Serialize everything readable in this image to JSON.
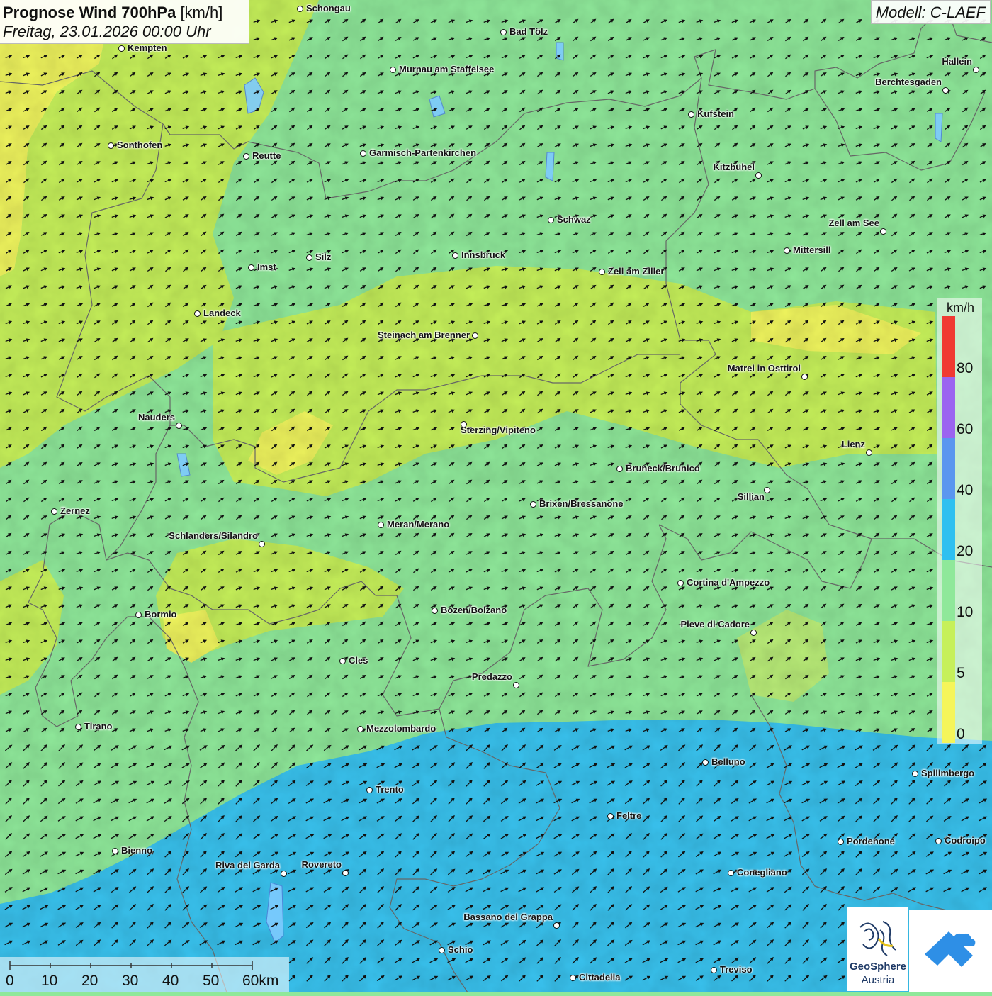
{
  "title": {
    "bold": "Prognose Wind 700hPa",
    "unit": "[km/h]",
    "date": "Freitag, 23.01.2026 00:00 Uhr"
  },
  "model": "Modell: C-LAEF",
  "legend": {
    "unit": "km/h",
    "ticks": [
      "80",
      "60",
      "40",
      "20",
      "10",
      "5",
      "0"
    ],
    "colors": {
      "above_80": "#f03a32",
      "60_80": "#9b64f0",
      "40_60": "#5a96ef",
      "20_40": "#2ec0f0",
      "10_20": "#8fe89a",
      "5_10": "#c6f05a",
      "0_5": "#f5f55a"
    }
  },
  "scale": {
    "labels": [
      "0",
      "10",
      "20",
      "30",
      "40",
      "50",
      "60km"
    ]
  },
  "logo": {
    "name": "GeoSphere",
    "sub": "Austria"
  },
  "wind": {
    "direction": "northeast (from southwest)",
    "speed_zones": "mostly 10–20 km/h; 5–10 km/h band across central Tyrol and South Tyrol; 20–40 km/h in the southern Veneto plain"
  },
  "cities": [
    {
      "name": "Schongau"
    },
    {
      "name": "Bad Tölz"
    },
    {
      "name": "Kempten"
    },
    {
      "name": "Murnau am Staffelsee"
    },
    {
      "name": "Hallein"
    },
    {
      "name": "Berchtesgaden"
    },
    {
      "name": "Kufstein"
    },
    {
      "name": "Sonthofen"
    },
    {
      "name": "Reutte"
    },
    {
      "name": "Garmisch-Partenkirchen"
    },
    {
      "name": "Kitzbühel"
    },
    {
      "name": "Schwaz"
    },
    {
      "name": "Zell am See"
    },
    {
      "name": "Mittersill"
    },
    {
      "name": "Imst"
    },
    {
      "name": "Silz"
    },
    {
      "name": "Innsbruck"
    },
    {
      "name": "Zell am Ziller"
    },
    {
      "name": "Landeck"
    },
    {
      "name": "Steinach am Brenner"
    },
    {
      "name": "Matrei in Osttirol"
    },
    {
      "name": "Nauders"
    },
    {
      "name": "Sterzing/Vipiteno"
    },
    {
      "name": "Lienz"
    },
    {
      "name": "Bruneck/Brunico"
    },
    {
      "name": "Sillian"
    },
    {
      "name": "Zernez"
    },
    {
      "name": "Brixen/Bressanone"
    },
    {
      "name": "Meran/Merano"
    },
    {
      "name": "Schlanders/Silandro"
    },
    {
      "name": "Cortina d'Ampezzo"
    },
    {
      "name": "Bozen/Bolzano"
    },
    {
      "name": "Bormio"
    },
    {
      "name": "Pieve di Cadore"
    },
    {
      "name": "Cles"
    },
    {
      "name": "Predazzo"
    },
    {
      "name": "Tirano"
    },
    {
      "name": "Mezzolombardo"
    },
    {
      "name": "Belluno"
    },
    {
      "name": "Spilimbergo"
    },
    {
      "name": "Trento"
    },
    {
      "name": "Feltre"
    },
    {
      "name": "Pordenone"
    },
    {
      "name": "Codroipo"
    },
    {
      "name": "Bienno"
    },
    {
      "name": "Riva del Garda"
    },
    {
      "name": "Rovereto"
    },
    {
      "name": "Conegliano"
    },
    {
      "name": "Bassano del Grappa"
    },
    {
      "name": "Schio"
    },
    {
      "name": "Treviso"
    },
    {
      "name": "Cittadella"
    }
  ]
}
